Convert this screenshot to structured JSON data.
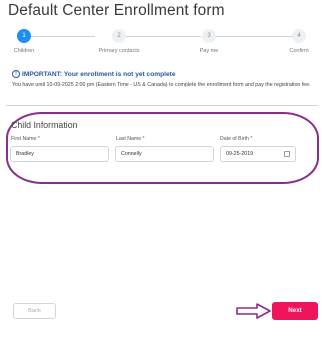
{
  "page": {
    "title": "Default Center Enrollment form"
  },
  "stepper": {
    "steps": [
      {
        "number": "1",
        "label": "Children",
        "active": true
      },
      {
        "number": "2",
        "label": "Primary contacts",
        "active": false
      },
      {
        "number": "3",
        "label": "Pay me",
        "active": false
      },
      {
        "number": "4",
        "label": "Confirm",
        "active": false
      }
    ]
  },
  "alert": {
    "icon": "!",
    "heading": "IMPORTANT: Your enrollment is not yet complete",
    "body": "You have until 10-09-2025 2:00 pm (Eastern Time - US & Canada) to complete the enrollment form and pay the registration fee."
  },
  "child_info": {
    "title": "Child Information",
    "first_name": {
      "label": "First Name",
      "value": "Bradley"
    },
    "last_name": {
      "label": "Last Name",
      "value": "Connelly"
    },
    "dob": {
      "label": "Date of Birth",
      "value": "09-25-2019"
    },
    "required_marker": "*"
  },
  "actions": {
    "back_label": "Back",
    "next_label": "Next"
  },
  "colors": {
    "accent_blue": "#1f8ef1",
    "alert_blue": "#2a55a3",
    "next_button": "#f0145a",
    "annotation_purple": "#8b2d8c"
  },
  "icons": {
    "info": "info-icon",
    "calendar": "calendar-icon",
    "annotation_arrow": "arrow-right-icon"
  }
}
